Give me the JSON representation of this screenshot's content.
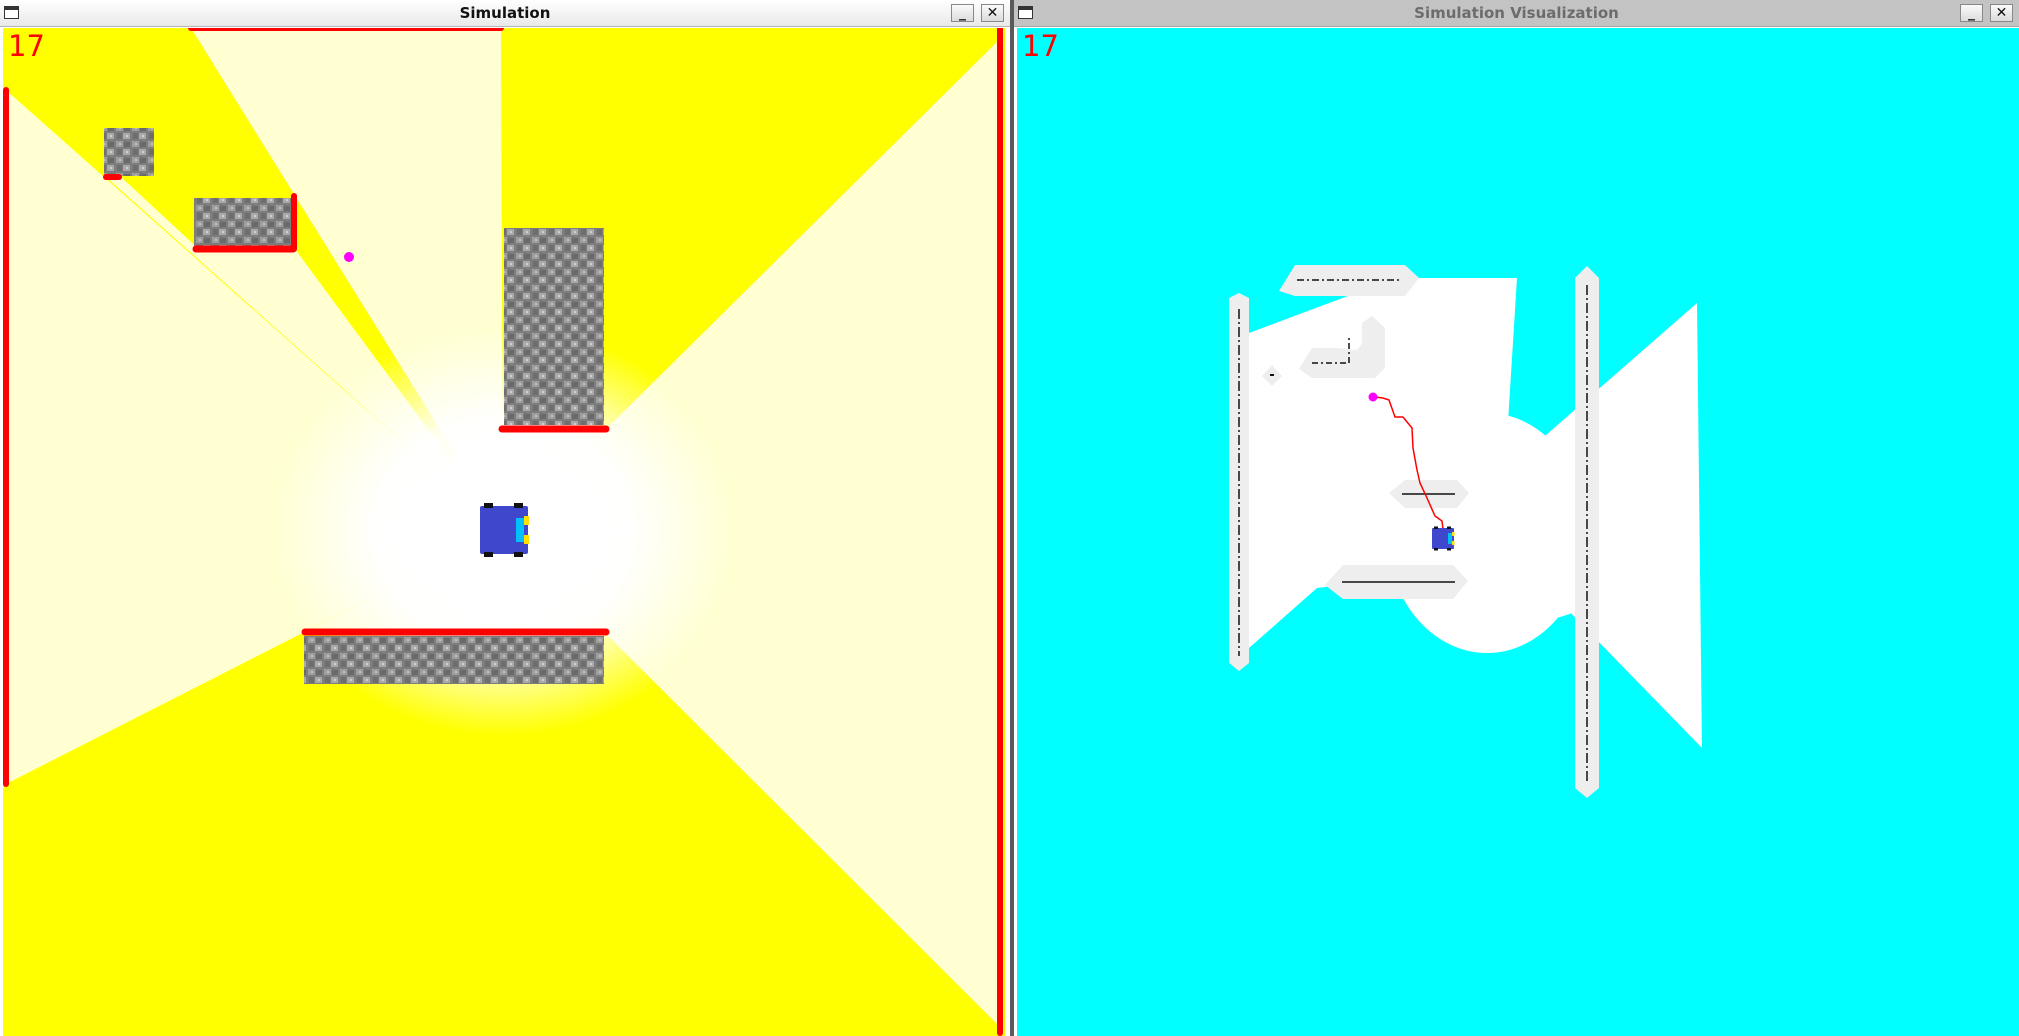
{
  "windows": {
    "sim": {
      "title": "Simulation",
      "counter": "17",
      "background": "#ffff00"
    },
    "viz": {
      "title": "Simulation Visualization",
      "counter": "17",
      "background": "#00ffff"
    }
  },
  "buttons": {
    "minimize": "_",
    "close": "✕"
  },
  "colors": {
    "ray": "#ffffff",
    "lidar_hit": "#ff0000",
    "goal": "#ff00ff",
    "obstacle": "#8a8a8a",
    "robot_body": "#3f47cc",
    "robot_accent": "#00c0ff",
    "robot_light": "#ffe000",
    "path": "#ff0000",
    "occupied_region": "#eeeeee"
  },
  "icons": [
    "window-menu-icon",
    "minimize-icon",
    "close-icon",
    "robot-icon",
    "goal-marker-icon"
  ]
}
